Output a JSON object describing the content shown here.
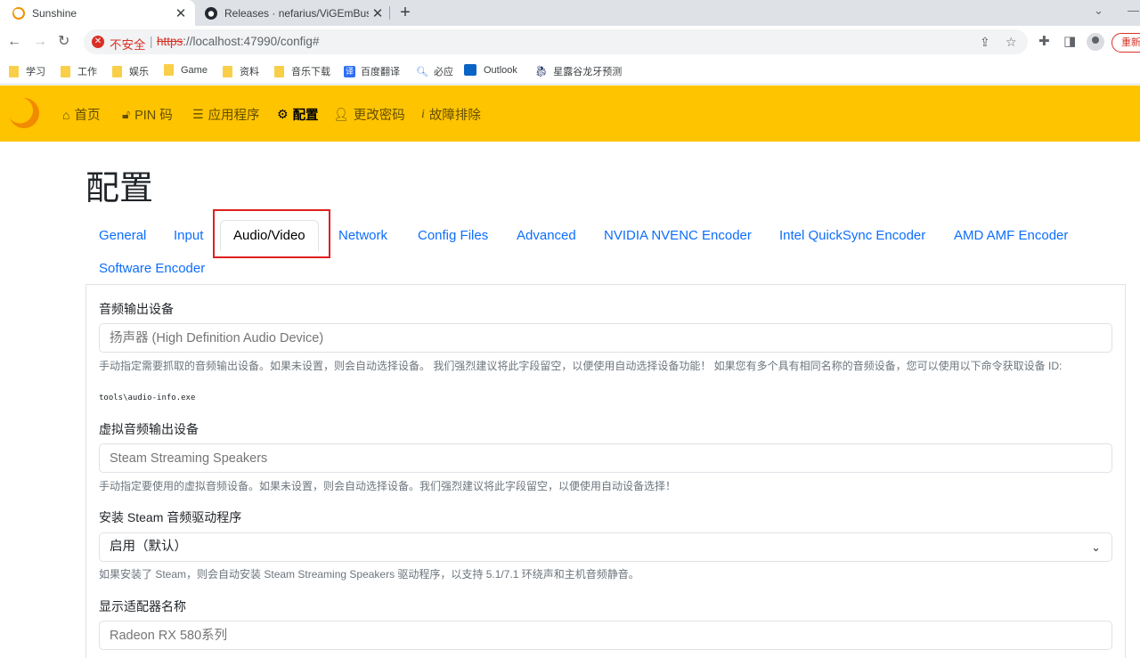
{
  "browser": {
    "tabs": [
      {
        "title": "Sunshine",
        "active": true,
        "icon": "sunshine-favicon"
      },
      {
        "title": "Releases · nefarius/ViGEmBus",
        "active": false,
        "icon": "github-favicon"
      }
    ],
    "new_tab_symbol": "+",
    "security_label": "不安全",
    "url_scheme": "https",
    "url_rest": "://localhost:47990/config#",
    "url_host_part": "localhost",
    "restart_label": "重新",
    "bookmarks": [
      {
        "label": "学习",
        "icon": "folder-icon"
      },
      {
        "label": "工作",
        "icon": "folder-icon"
      },
      {
        "label": "娱乐",
        "icon": "folder-icon"
      },
      {
        "label": "Game",
        "icon": "folder-icon"
      },
      {
        "label": "资料",
        "icon": "folder-icon"
      },
      {
        "label": "音乐下载",
        "icon": "folder-icon"
      },
      {
        "label": "百度翻译",
        "icon": "translate-icon"
      },
      {
        "label": "必应",
        "icon": "search-icon"
      },
      {
        "label": "Outlook",
        "icon": "outlook-icon"
      },
      {
        "label": "星露谷龙牙预测",
        "icon": "dragon-icon"
      }
    ]
  },
  "nav": {
    "items": [
      {
        "label": "首页",
        "icon": "home-icon",
        "glyph": "🏠"
      },
      {
        "label": "PIN 码",
        "icon": "lock-icon",
        "glyph": "🔓"
      },
      {
        "label": "应用程序",
        "icon": "list-icon",
        "glyph": "☰"
      },
      {
        "label": "配置",
        "icon": "gear-icon",
        "glyph": "⚙"
      },
      {
        "label": "更改密码",
        "icon": "user-key-icon",
        "glyph": "👤"
      },
      {
        "label": "故障排除",
        "icon": "info-icon",
        "glyph": "ℹ"
      }
    ],
    "active_index": 3,
    "brand_color": "#ffc400"
  },
  "page": {
    "title": "配置",
    "tabs": [
      "General",
      "Input",
      "Audio/Video",
      "Network",
      "Config Files",
      "Advanced",
      "NVIDIA NVENC Encoder",
      "Intel QuickSync Encoder",
      "AMD AMF Encoder",
      "Software Encoder"
    ],
    "active_tab_index": 2,
    "highlight_color": "#e02020",
    "link_color": "#0d6efd"
  },
  "form": {
    "audio_sink": {
      "label": "音频输出设备",
      "placeholder": "扬声器 (High Definition Audio Device)",
      "help": "手动指定需要抓取的音频输出设备。如果未设置，则会自动选择设备。 我们强烈建议将此字段留空，以便使用自动选择设备功能！ 如果您有多个具有相同名称的音频设备，您可以使用以下命令获取设备 ID:",
      "command": "tools\\audio-info.exe"
    },
    "virtual_sink": {
      "label": "虚拟音频输出设备",
      "placeholder": "Steam Streaming Speakers",
      "help": "手动指定要使用的虚拟音频设备。如果未设置，则会自动选择设备。我们强烈建议将此字段留空，以便使用自动设备选择！"
    },
    "install_steam_drivers": {
      "label": "安装 Steam 音频驱动程序",
      "value": "启用（默认）",
      "help": "如果安装了 Steam，则会自动安装 Steam Streaming Speakers 驱动程序，以支持 5.1/7.1 环绕声和主机音频静音。"
    },
    "adapter_name": {
      "label": "显示适配器名称",
      "placeholder": "Radeon RX 580系列"
    }
  }
}
